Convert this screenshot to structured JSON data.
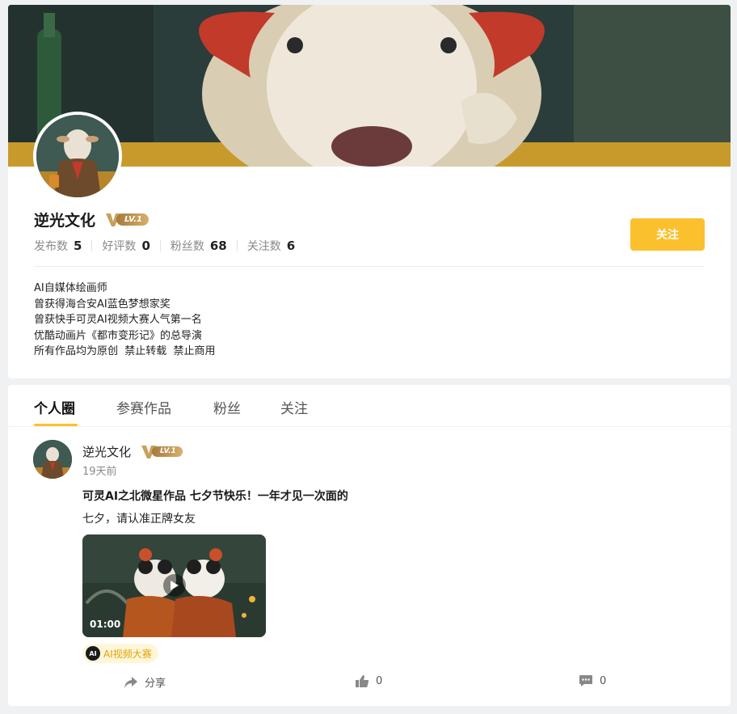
{
  "profile": {
    "name": "逆光文化",
    "level": "LV.1",
    "stats": [
      {
        "label": "发布数",
        "value": "5"
      },
      {
        "label": "好评数",
        "value": "0"
      },
      {
        "label": "粉丝数",
        "value": "68"
      },
      {
        "label": "关注数",
        "value": "6"
      }
    ],
    "follow_label": "关注",
    "bio": [
      "AI自媒体绘画师",
      "曾获得海合安AI蓝色梦想家奖",
      "曾获快手可灵AI视频大赛人气第一名",
      "优酷动画片《都市变形记》的总导演",
      "所有作品均为原创  禁止转载  禁止商用"
    ]
  },
  "tabs": [
    {
      "label": "个人圈",
      "active": true
    },
    {
      "label": "参赛作品",
      "active": false
    },
    {
      "label": "粉丝",
      "active": false
    },
    {
      "label": "关注",
      "active": false
    }
  ],
  "post": {
    "author": "逆光文化",
    "level": "LV.1",
    "time": "19天前",
    "title": "可灵AI之北微星作品 七夕节快乐！一年才见一次面的",
    "text": "七夕，请认准正牌女友",
    "video_duration": "01:00",
    "tag_icon_text": "AI",
    "tag_label": "AI视频大赛",
    "share_label": "分享",
    "like_count": "0",
    "comment_count": "0"
  },
  "icons": [
    "play-icon",
    "share-icon",
    "thumbs-up-icon",
    "comment-icon",
    "level-v-icon"
  ],
  "colors": {
    "accent": "#fbc02d",
    "level_gold": "#c9a05a",
    "tag_text": "#e0a400"
  }
}
